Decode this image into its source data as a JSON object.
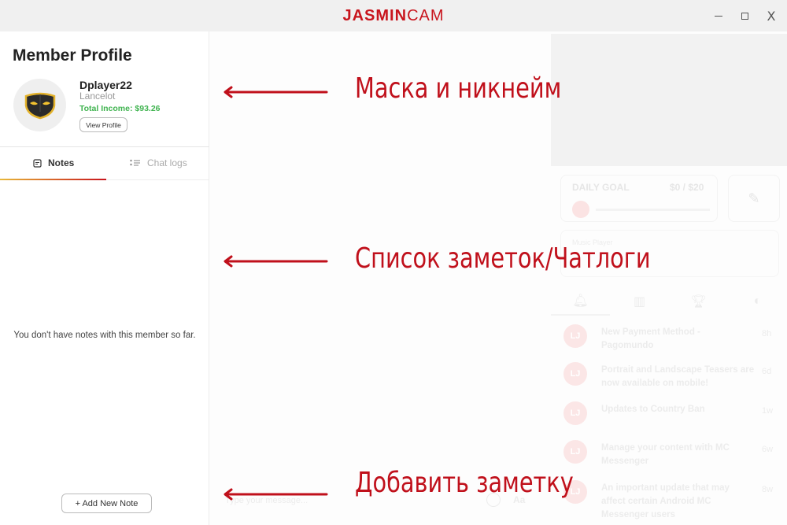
{
  "window": {
    "logo_bold": "JASMIN",
    "logo_light": "CAM",
    "controls": {
      "minimize": "minimize",
      "maximize": "maximize",
      "close": "X"
    }
  },
  "profile": {
    "title": "Member Profile",
    "username": "Dplayer22",
    "realname": "Lancelot",
    "income": "Total Income: $93.26",
    "view_profile": "View Profile",
    "avatar_icon": "mask-icon"
  },
  "tabs": [
    {
      "label": "Notes",
      "icon": "note-icon",
      "active": true
    },
    {
      "label": "Chat logs",
      "icon": "list-icon",
      "active": false
    }
  ],
  "notes": {
    "empty_message": "You don't have notes with this member so far.",
    "add_button": "+ Add New Note"
  },
  "background": {
    "daily_goal_label": "DAILY GOAL",
    "daily_goal_value": "$0 / $20",
    "music_label": "Music Player",
    "notifications": [
      {
        "text": "New Payment Method - Pagomundo",
        "time": "8h"
      },
      {
        "text": "Portrait and Landscape Teasers are now available on mobile!",
        "time": "6d"
      },
      {
        "text": "Updates to Country Ban",
        "time": "1w"
      },
      {
        "text": "Manage your content with MC Messenger",
        "time": "6w"
      },
      {
        "text": "An important update that may affect certain Android MC Messenger users",
        "time": "8w"
      }
    ],
    "message_placeholder": "Type your message...",
    "font_toggle": "Aa"
  },
  "annotations": {
    "mask_nickname": "Маска и никнейм",
    "notes_chatlogs": "Список заметок/Чатлоги",
    "add_note": "Добавить заметку",
    "color": "#c0101b"
  },
  "colors": {
    "brand": "#c8151d",
    "income": "#3fb34f"
  }
}
